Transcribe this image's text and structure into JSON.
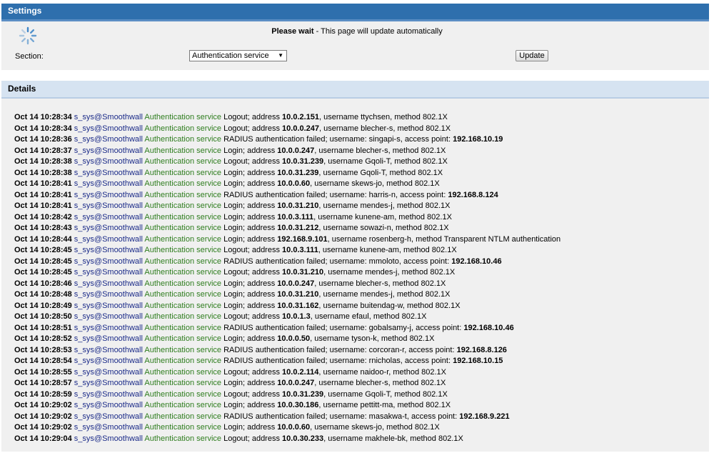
{
  "settings": {
    "title": "Settings",
    "wait_bold": "Please wait",
    "wait_rest": " - This page will update automatically",
    "section_label": "Section:",
    "section_value": "Authentication service",
    "update_label": "Update"
  },
  "details": {
    "title": "Details",
    "user_host": "s_sys@Smoothwall",
    "service": "Authentication service",
    "entries": [
      {
        "ts": "Oct 14 10:28:34",
        "pre": " Logout; address ",
        "ip": "10.0.2.151",
        "post": ", username ttychsen, method 802.1X"
      },
      {
        "ts": "Oct 14 10:28:34",
        "pre": " Logout; address ",
        "ip": "10.0.0.247",
        "post": ", username blecher-s, method 802.1X"
      },
      {
        "ts": "Oct 14 10:28:36",
        "pre": " RADIUS authentication failed; username: singapi-s, access point: ",
        "ip": "192.168.10.19",
        "post": ""
      },
      {
        "ts": "Oct 14 10:28:37",
        "pre": " Login; address ",
        "ip": "10.0.0.247",
        "post": ", username blecher-s, method 802.1X"
      },
      {
        "ts": "Oct 14 10:28:38",
        "pre": " Logout; address ",
        "ip": "10.0.31.239",
        "post": ", username Gqoli-T, method 802.1X"
      },
      {
        "ts": "Oct 14 10:28:38",
        "pre": " Login; address ",
        "ip": "10.0.31.239",
        "post": ", username Gqoli-T, method 802.1X"
      },
      {
        "ts": "Oct 14 10:28:41",
        "pre": " Login; address ",
        "ip": "10.0.0.60",
        "post": ", username skews-jo, method 802.1X"
      },
      {
        "ts": "Oct 14 10:28:41",
        "pre": " RADIUS authentication failed; username: harris-n, access point: ",
        "ip": "192.168.8.124",
        "post": ""
      },
      {
        "ts": "Oct 14 10:28:41",
        "pre": " Login; address ",
        "ip": "10.0.31.210",
        "post": ", username mendes-j, method 802.1X"
      },
      {
        "ts": "Oct 14 10:28:42",
        "pre": " Login; address ",
        "ip": "10.0.3.111",
        "post": ", username kunene-am, method 802.1X"
      },
      {
        "ts": "Oct 14 10:28:43",
        "pre": " Login; address ",
        "ip": "10.0.31.212",
        "post": ", username sowazi-n, method 802.1X"
      },
      {
        "ts": "Oct 14 10:28:44",
        "pre": " Login; address ",
        "ip": "192.168.9.101",
        "post": ", username rosenberg-h, method Transparent NTLM authentication"
      },
      {
        "ts": "Oct 14 10:28:45",
        "pre": " Logout; address ",
        "ip": "10.0.3.111",
        "post": ", username kunene-am, method 802.1X"
      },
      {
        "ts": "Oct 14 10:28:45",
        "pre": " RADIUS authentication failed; username: mmoloto, access point: ",
        "ip": "192.168.10.46",
        "post": ""
      },
      {
        "ts": "Oct 14 10:28:45",
        "pre": " Logout; address ",
        "ip": "10.0.31.210",
        "post": ", username mendes-j, method 802.1X"
      },
      {
        "ts": "Oct 14 10:28:46",
        "pre": " Login; address ",
        "ip": "10.0.0.247",
        "post": ", username blecher-s, method 802.1X"
      },
      {
        "ts": "Oct 14 10:28:48",
        "pre": " Login; address ",
        "ip": "10.0.31.210",
        "post": ", username mendes-j, method 802.1X"
      },
      {
        "ts": "Oct 14 10:28:49",
        "pre": " Login; address ",
        "ip": "10.0.31.162",
        "post": ", username buitendag-w, method 802.1X"
      },
      {
        "ts": "Oct 14 10:28:50",
        "pre": " Logout; address ",
        "ip": "10.0.1.3",
        "post": ", username efaul, method 802.1X"
      },
      {
        "ts": "Oct 14 10:28:51",
        "pre": " RADIUS authentication failed; username: gobalsamy-j, access point: ",
        "ip": "192.168.10.46",
        "post": ""
      },
      {
        "ts": "Oct 14 10:28:52",
        "pre": " Login; address ",
        "ip": "10.0.0.50",
        "post": ", username tyson-k, method 802.1X"
      },
      {
        "ts": "Oct 14 10:28:53",
        "pre": " RADIUS authentication failed; username: corcoran-r, access point: ",
        "ip": "192.168.8.126",
        "post": ""
      },
      {
        "ts": "Oct 14 10:28:54",
        "pre": " RADIUS authentication failed; username: rnicholas, access point: ",
        "ip": "192.168.10.15",
        "post": ""
      },
      {
        "ts": "Oct 14 10:28:55",
        "pre": " Logout; address ",
        "ip": "10.0.2.114",
        "post": ", username naidoo-r, method 802.1X"
      },
      {
        "ts": "Oct 14 10:28:57",
        "pre": " Login; address ",
        "ip": "10.0.0.247",
        "post": ", username blecher-s, method 802.1X"
      },
      {
        "ts": "Oct 14 10:28:59",
        "pre": " Logout; address ",
        "ip": "10.0.31.239",
        "post": ", username Gqoli-T, method 802.1X"
      },
      {
        "ts": "Oct 14 10:29:02",
        "pre": " Login; address ",
        "ip": "10.0.30.186",
        "post": ", username pettitt-ma, method 802.1X"
      },
      {
        "ts": "Oct 14 10:29:02",
        "pre": " RADIUS authentication failed; username: masakwa-t, access point: ",
        "ip": "192.168.9.221",
        "post": ""
      },
      {
        "ts": "Oct 14 10:29:02",
        "pre": " Login; address ",
        "ip": "10.0.0.60",
        "post": ", username skews-jo, method 802.1X"
      },
      {
        "ts": "Oct 14 10:29:04",
        "pre": " Logout; address ",
        "ip": "10.0.30.233",
        "post": ", username makhele-bk, method 802.1X"
      }
    ]
  }
}
